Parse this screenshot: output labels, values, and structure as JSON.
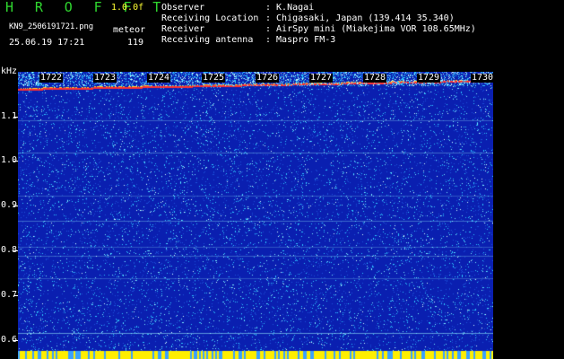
{
  "header": {
    "app_title": "H R O F F T",
    "version": "1.0.0f",
    "filename": "KN9_2506191721.png",
    "type_label": "meteor",
    "datetime": "25.06.19 17:21",
    "count": "119"
  },
  "info": [
    {
      "key": "Observer",
      "value": ": K.Nagai"
    },
    {
      "key": "Receiving Location",
      "value": ": Chigasaki, Japan (139.414 35.340)"
    },
    {
      "key": "Receiver",
      "value": ": AirSpy mini (Miakejima VOR 108.65MHz)"
    },
    {
      "key": "Receiving antenna",
      "value": ": Maspro FM-3"
    }
  ],
  "spectrogram": {
    "freq_unit": "kHz",
    "freq_ticks": [
      "1.1",
      "1.0",
      "0.9",
      "0.8",
      "0.7",
      "0.6"
    ],
    "time_labels": [
      "1722",
      "1723",
      "1724",
      "1725",
      "1726",
      "1727",
      "1728",
      "1729",
      "1730"
    ],
    "colors": {
      "background": "#0a1fb0",
      "noise": "#2ec8ff",
      "signal": "#ff3030",
      "bottom_band": "#ffee00"
    }
  }
}
